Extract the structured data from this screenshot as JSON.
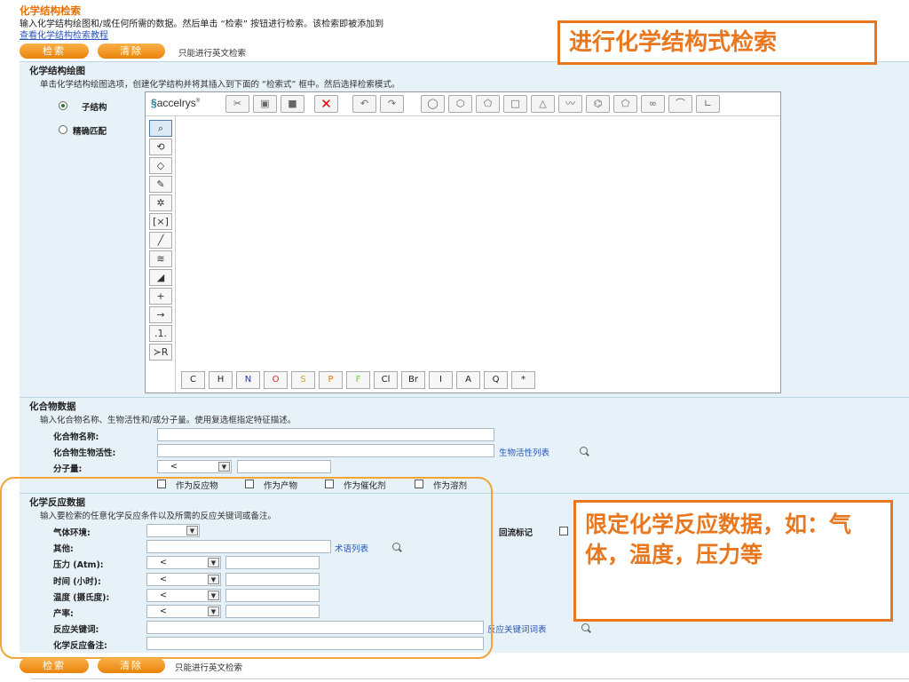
{
  "page": {
    "title": "化学结构检索",
    "description": "输入化学结构绘图和/或任何所需的数据。然后单击 “检索” 按钮进行检索。该检索即被添加到",
    "tutorial_link": "查看化学结构检索教程"
  },
  "top_actions": {
    "search_label": "检索",
    "clear_label": "清除",
    "note": "只能进行英文检索"
  },
  "structure_panel": {
    "title": "化学结构绘图",
    "description": "单击化学结构绘图选项，创建化学结构并将其插入到下面的 “检索式” 框中。然后选择检索模式。",
    "modes": [
      {
        "label": "子结构",
        "selected": true
      },
      {
        "label": "精确匹配",
        "selected": false
      }
    ],
    "editor": {
      "logo_text": "accelrys",
      "elements": [
        "C",
        "H",
        "N",
        "O",
        "S",
        "P",
        "F",
        "Cl",
        "Br",
        "I",
        "A",
        "Q",
        "*"
      ],
      "element_colors": {
        "N": "#2233cc",
        "O": "#dd2222",
        "S": "#d6a800",
        "P": "#e07000",
        "F": "#66cc33",
        "C": "#222222",
        "H": "#222222",
        "Cl": "#222222",
        "Br": "#222222",
        "I": "#222222",
        "A": "#222222",
        "Q": "#222222",
        "*": "#222222"
      }
    }
  },
  "compound_panel": {
    "title": "化合物数据",
    "description": "输入化合物名称、生物活性和/或分子量。使用复选框指定特征描述。",
    "name_label": "化合物名称:",
    "bioactivity_label": "化合物生物活性:",
    "bioactivity_link": "生物活性列表",
    "mw_label": "分子量:",
    "mw_operator": "<",
    "roles": [
      "作为反应物",
      "作为产物",
      "作为催化剂",
      "作为溶剂"
    ]
  },
  "reaction_panel": {
    "title": "化学反应数据",
    "description": "输入要检索的任意化学反应条件以及所需的反应关键词或备注。",
    "atmosphere_label": "气体环境:",
    "other_label": "其他:",
    "term_list_link": "术语列表",
    "pressure_label": "压力 (Atm):",
    "time_label": "时间 (小时):",
    "temperature_label": "温度 (摄氏度):",
    "yield_label": "产率:",
    "operator": "<",
    "keywords_label": "反应关键词:",
    "keywords_link": "反应关键词词表",
    "notes_label": "化学反应备注:",
    "reflux_label": "回流标记"
  },
  "bottom_actions": {
    "search_label": "检索",
    "clear_label": "清除",
    "note": "只能进行英文检索"
  },
  "callouts": {
    "structure": "进行化学结构式检索",
    "reaction": "限定化学反应数据，如：气体，温度，压力等"
  }
}
